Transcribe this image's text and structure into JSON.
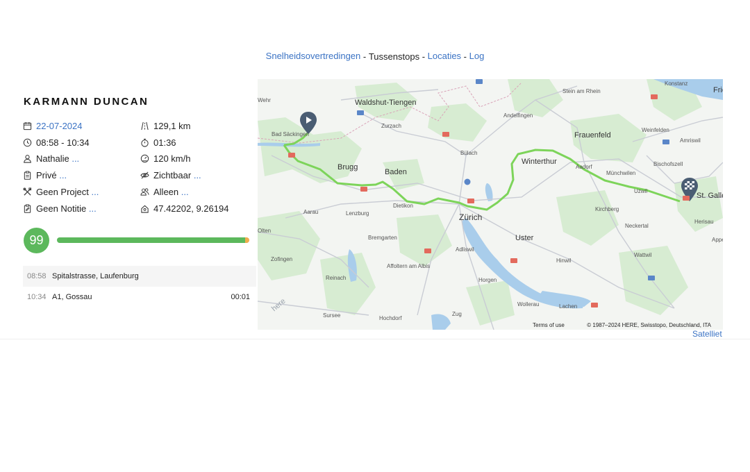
{
  "nav": {
    "items": [
      {
        "label": "Snelheidsovertredingen",
        "link": true
      },
      {
        "label": "Tussenstops",
        "link": false
      },
      {
        "label": "Locaties",
        "link": true
      },
      {
        "label": "Log",
        "link": true
      }
    ],
    "separator": " - "
  },
  "driver": {
    "name": "KARMANN DUNCAN"
  },
  "details": {
    "date": "22-07-2024",
    "time_range": "08:58 - 10:34",
    "driver_name": "Nathalie",
    "more": "...",
    "category": "Privé",
    "project": "Geen Project",
    "note": "Geen Notitie",
    "distance": "129,1 km",
    "duration": "01:36",
    "max_speed": "120 km/h",
    "visibility": "Zichtbaar",
    "company": "Alleen",
    "coordinates": "47.42202, 9.26194"
  },
  "score": {
    "value": "99",
    "fill_percent": 99
  },
  "stops": [
    {
      "time": "08:58",
      "address": "Spitalstrasse, Laufenburg",
      "duration": ""
    },
    {
      "time": "10:34",
      "address": "A1, Gossau",
      "duration": "00:01"
    }
  ],
  "map": {
    "places": {
      "konstanz": "Konstanz",
      "stein": "Stein am Rhein",
      "waldshut": "Waldshut-Tiengen",
      "andelfingen": "Andelfingen",
      "frauenfeld": "Frauenfeld",
      "weinfelden": "Weinfelden",
      "amriswil": "Amriswil",
      "wehr": "Wehr",
      "badsack": "Bad Säckingen",
      "zurzach": "Zurzach",
      "bulach": "Bülach",
      "winterthur": "Winterthur",
      "aadorf": "Aadorf",
      "munchwilen": "Münchwilen",
      "bischofszell": "Bischofszell",
      "uzwil": "Uzwil",
      "stgallen": "St. Gallen",
      "brugg": "Brugg",
      "baden": "Baden",
      "dietikon": "Dietikon",
      "zurich": "Zürich",
      "kirchberg": "Kirchberg",
      "herisau": "Herisau",
      "olten": "Olten",
      "aarau": "Aarau",
      "lenzburg": "Lenzburg",
      "bremgarten": "Bremgarten",
      "adliswil": "Adliswil",
      "uster": "Uster",
      "neckertal": "Neckertal",
      "appenzell": "Appe",
      "zofingen": "Zofingen",
      "affoltern": "Affoltern am Albis",
      "hinwil": "Hinwil",
      "wattwil": "Wattwil",
      "reinach": "Reinach",
      "horgen": "Horgen",
      "wollerau": "Wollerau",
      "lachen": "Lachen",
      "sursee": "Sursee",
      "hochdorf": "Hochdorf",
      "zug": "Zug",
      "frie": "Frie"
    },
    "watermark": "here",
    "terms": "Terms of use",
    "attribution": "© 1987–2024 HERE, Swisstopo, Deutschland, ITA",
    "colors": {
      "route": "#7dd45a",
      "marker": "#4a5d73",
      "water": "#a9cdeb",
      "forest": "#d7ecd2"
    }
  },
  "satellite_label": "Satelliet"
}
